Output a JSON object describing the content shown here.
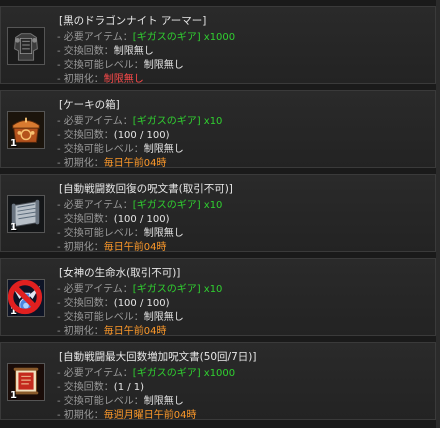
{
  "labels": {
    "required_item": "- 必要アイテム：",
    "exchange_count": "- 交換回数：",
    "exchange_level": "- 交換可能レベル：",
    "reset": "- 初期化："
  },
  "items": [
    {
      "title": "[黒のドラゴンナイト アーマー]",
      "required": "[ギガスのギア] x1000",
      "count": "制限無し",
      "level": "制限無し",
      "reset": "制限無し",
      "stack": "",
      "icon": "armor-icon"
    },
    {
      "title": "[ケーキの箱]",
      "required": "[ギガスのギア] x10",
      "count": "(100 / 100)",
      "level": "制限無し",
      "reset": "毎日午前04時",
      "stack": "1",
      "icon": "cake-box-icon"
    },
    {
      "title": "[自動戦闘数回復の呪文書(取引不可)]",
      "required": "[ギガスのギア] x10",
      "count": "(100 / 100)",
      "level": "制限無し",
      "reset": "毎日午前04時",
      "stack": "1",
      "icon": "scroll-icon"
    },
    {
      "title": "[女神の生命水(取引不可)]",
      "required": "[ギガスのギア] x10",
      "count": "(100 / 100)",
      "level": "制限無し",
      "reset": "毎日午前04時",
      "stack": "1",
      "icon": "potion-icon"
    },
    {
      "title": "[自動戦闘最大回数増加呪文書(50回/7日)]",
      "required": "[ギガスのギア] x1000",
      "count": "(1 / 1)",
      "level": "制限無し",
      "reset": "毎週月曜日午前04時",
      "stack": "1",
      "icon": "red-scroll-icon"
    }
  ],
  "colors": {
    "label": "#9a9a9a",
    "value": "#e6e6e6",
    "required": "#30d030",
    "unlimited_red": "#ff4a4a",
    "reset_orange": "#ff9a2a"
  }
}
